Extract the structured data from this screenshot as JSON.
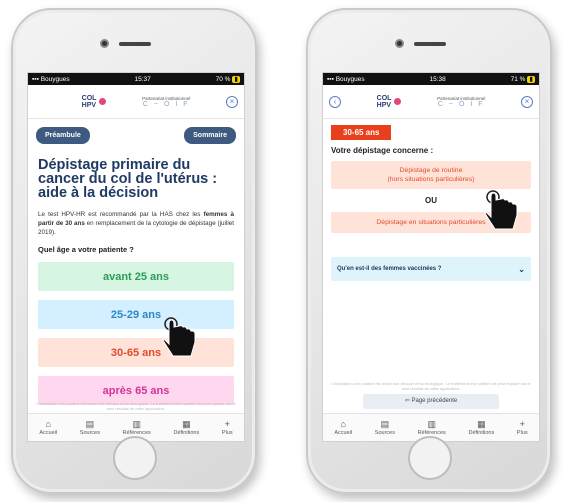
{
  "left": {
    "status": {
      "carrier": "Bouygues",
      "time": "15:37",
      "battery": "70 %"
    },
    "header": {
      "logo_line1": "COL",
      "logo_line2": "HPV",
      "partner_label": "Partenariat institutionnel",
      "partner_symbol": "C ~ O I F"
    },
    "buttons": {
      "preambule": "Préambule",
      "sommaire": "Sommaire"
    },
    "title": "Dépistage primaire du cancer du col de l'utérus : aide à la décision",
    "intro_parts": [
      "Le test HPV-HR est recommandé par la HAS chez les ",
      "femmes à partir de 30 ans",
      " en remplacement de la cytologie de dépistage (juillet 2019)."
    ],
    "question": "Quel âge a votre patiente ?",
    "choices": [
      "avant 25 ans",
      "25-29 ans",
      "30-65 ans",
      "après 65 ans"
    ],
    "choice_colors": {
      "green": "#2a9d55",
      "blue": "#2f87c8",
      "orange": "#e04b2a",
      "pink": "#d4339a"
    },
    "footnote": "L'évaluation d'un patient est avant tout clinique et/ou biologique. Le traitement d'un patient ne peut reposer sur le seul résultat de cette application.",
    "tabs": [
      {
        "icon": "home-icon",
        "label": "Accueil"
      },
      {
        "icon": "document-icon",
        "label": "Sources"
      },
      {
        "icon": "book-icon",
        "label": "Références"
      },
      {
        "icon": "glossary-icon",
        "label": "Définitions"
      },
      {
        "icon": "plus-icon",
        "label": "Plus"
      }
    ]
  },
  "right": {
    "status": {
      "carrier": "Bouygues",
      "time": "15:38",
      "battery": "71 %"
    },
    "age_badge": "30-65 ans",
    "concern": "Votre dépistage concerne :",
    "option1_line1": "Dépistage de routine",
    "option1_line2": "(hors situations particulières)",
    "or_label": "OU",
    "option2": "Dépistage en situations particulières",
    "accordion": "Qu'en est-il des femmes vaccinées ?",
    "footnote": "L'évaluation d'un patient est avant tout clinique et/ou biologique. Le traitement d'un patient ne peut reposer sur le seul résultat de cette application.",
    "prev_button": "Page précédente",
    "accent": "#e8401d"
  }
}
